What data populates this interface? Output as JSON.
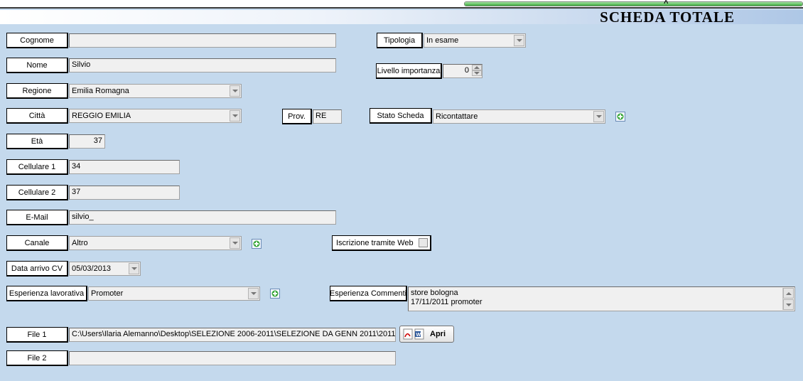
{
  "window": {
    "title": "SCHEDA TOTALE",
    "progress_fraction": 1.0
  },
  "labels": {
    "cognome": "Cognome",
    "nome": "Nome",
    "regione": "Regione",
    "citta": "Città",
    "eta": "Età",
    "cellulare1": "Cellulare 1",
    "cellulare2": "Cellulare 2",
    "email": "E-Mail",
    "canale": "Canale",
    "data_arrivo": "Data arrivo CV",
    "esperienza": "Esperienza lavorativa",
    "file1": "File 1",
    "file2": "File 2",
    "tipologia": "Tipologia",
    "livello": "Livello importanza",
    "prov": "Prov.",
    "stato": "Stato Scheda",
    "iscrizione": "Iscrizione tramite Web",
    "commenti": "Esperienza Commenti"
  },
  "values": {
    "cognome": "",
    "nome": "Silvio",
    "regione": "Emilia Romagna",
    "citta": "REGGIO EMILIA",
    "eta": "37",
    "cellulare1": "34",
    "cellulare2": "37",
    "email": "silvio_",
    "canale": "Altro",
    "data_arrivo": "05/03/2013",
    "esperienza": "Promoter",
    "file1": "C:\\Users\\Ilaria Alemanno\\Desktop\\SELEZIONE 2006-2011\\SELEZIONE DA GENN 2011\\2011",
    "file2": "",
    "tipologia": "In esame",
    "livello": "0",
    "prov": "RE",
    "stato": "Ricontattare",
    "iscrizione_checked": false,
    "commenti_line1": "store bologna",
    "commenti_line2": "17/11/2011 promoter"
  },
  "buttons": {
    "apri": "Apri"
  },
  "icons": [
    "pdf-icon",
    "word-icon",
    "add-icon",
    "chevron-down-icon",
    "spin-up-icon"
  ]
}
